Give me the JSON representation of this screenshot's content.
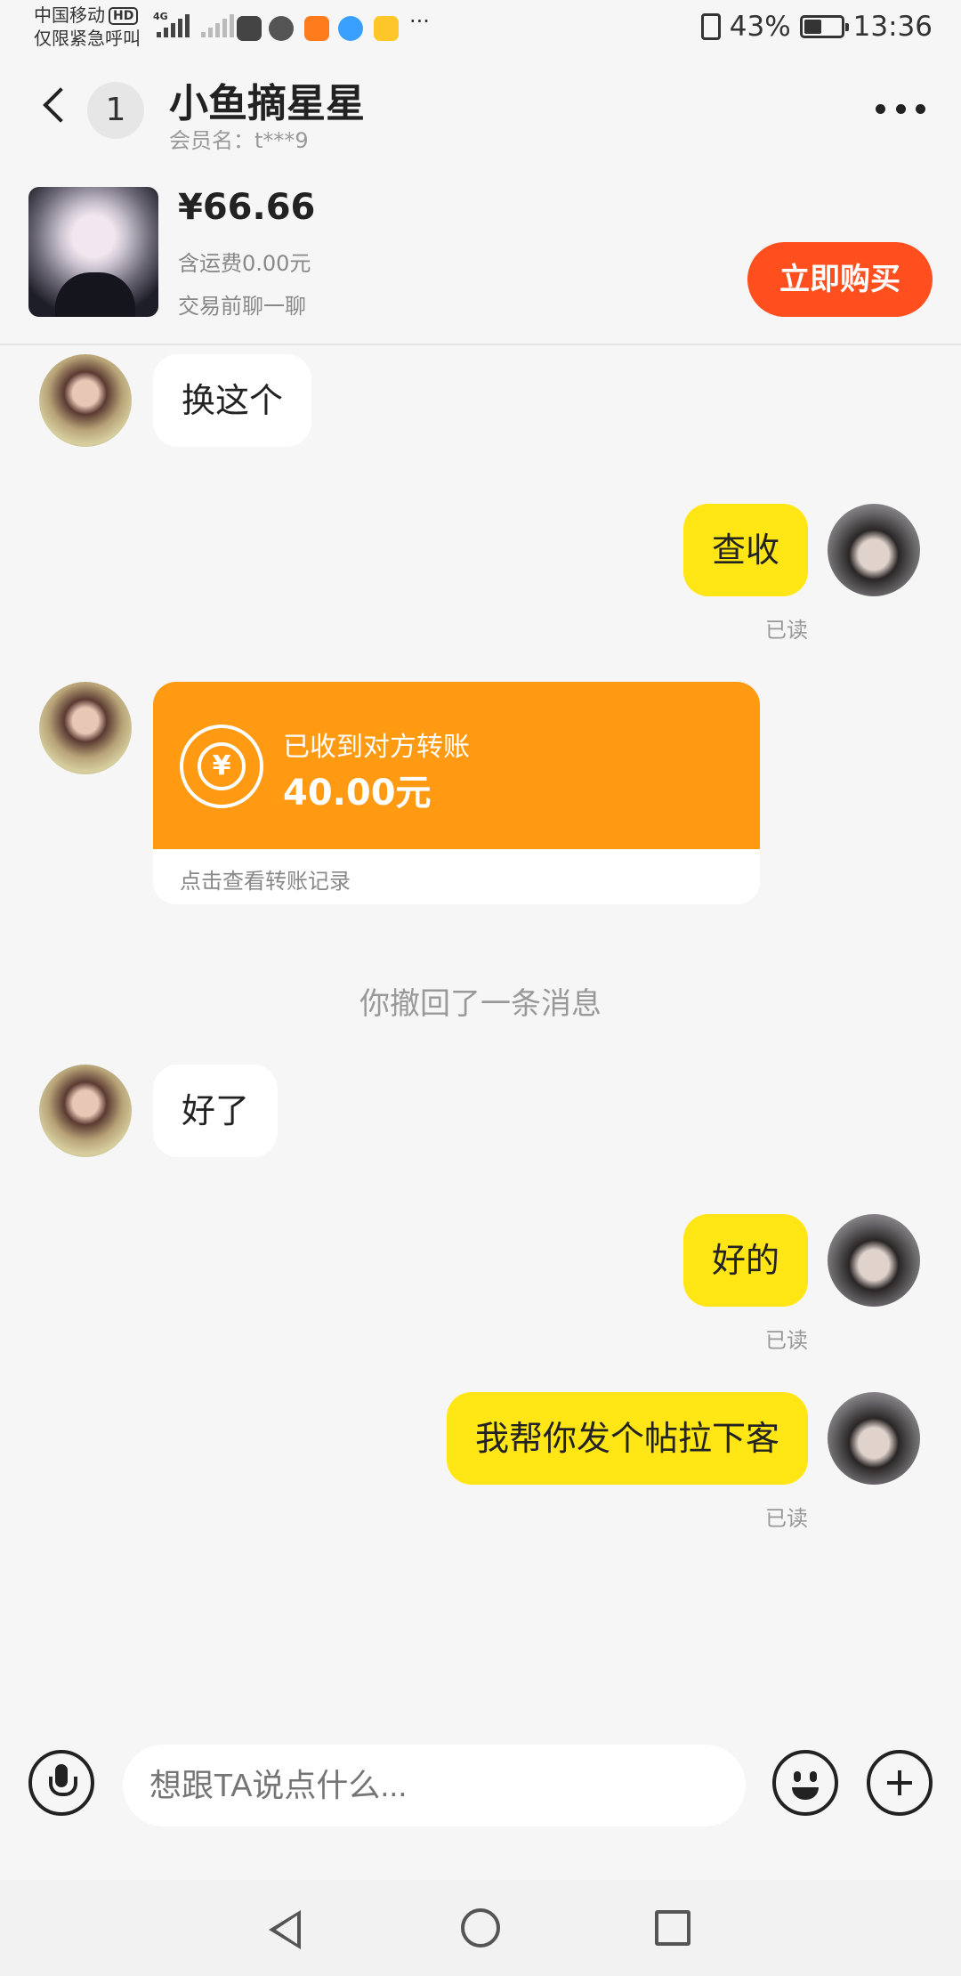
{
  "status_bar": {
    "carrier": "中国移动",
    "hd": "HD",
    "emergency": "仅限紧急呼叫",
    "network": "4G",
    "more": "···",
    "battery": "43%",
    "time": "13:36"
  },
  "header": {
    "back_icon": "chevron-left-icon",
    "unread_count": "1",
    "title": "小鱼摘星星",
    "member_name": "会员名：t***9",
    "more_icon": "more-dots-icon"
  },
  "product": {
    "price": "¥66.66",
    "shipping": "含运费0.00元",
    "chat_first": "交易前聊一聊",
    "buy_label": "立即购买"
  },
  "messages": [
    {
      "side": "in",
      "text": "换这个"
    },
    {
      "side": "out",
      "text": "查收",
      "status": "已读"
    },
    {
      "side": "in",
      "type": "transfer",
      "label": "已收到对方转账",
      "amount": "40.00元",
      "link": "点击查看转账记录",
      "icon": "yen-transfer-icon"
    },
    {
      "type": "system",
      "text": "你撤回了一条消息"
    },
    {
      "side": "in",
      "text": "好了"
    },
    {
      "side": "out",
      "text": "好的",
      "status": "已读"
    },
    {
      "side": "out",
      "text": "我帮你发个帖拉下客",
      "status": "已读"
    }
  ],
  "input": {
    "placeholder": "想跟TA说点什么...",
    "voice_icon": "microphone-icon",
    "emoji_icon": "emoji-icon",
    "plus_icon": "plus-icon"
  },
  "colors": {
    "buy_button": "#ff4f1f",
    "outgoing_bubble": "#ffe614",
    "transfer_card": "#ff9a12",
    "background": "#f6f6f6"
  }
}
